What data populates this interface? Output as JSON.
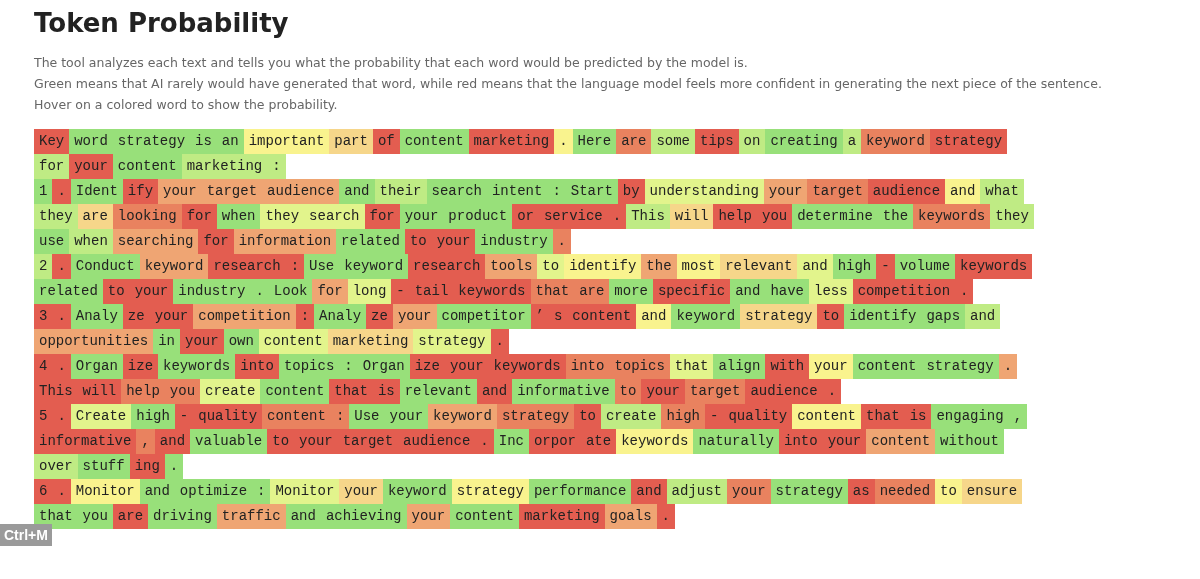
{
  "title": "Token Probability",
  "description": [
    "The tool analyzes each text and tells you what the probability that each word would be predicted by the model is.",
    "Green means that AI rarely would have generated that word, while red means that the language model feels more confident in generating the next piece of the sentence.",
    "Hover on a colored word to show the probability."
  ],
  "lines": [
    [
      {
        "text": "Key",
        "color": "#e35d50"
      },
      {
        "text": "word",
        "color": "#98e07a"
      },
      {
        "text": "strategy",
        "color": "#98e07a"
      },
      {
        "text": "is",
        "color": "#98e07a"
      },
      {
        "text": "an",
        "color": "#98e07a"
      },
      {
        "text": "important",
        "color": "#f9f38e"
      },
      {
        "text": "part",
        "color": "#f6d68a"
      },
      {
        "text": "of",
        "color": "#e35d50"
      },
      {
        "text": "content",
        "color": "#98e07a"
      },
      {
        "text": "marketing",
        "color": "#e35d50"
      },
      {
        "text": ".",
        "color": "#f9f38e"
      },
      {
        "text": "Here",
        "color": "#98e07a"
      },
      {
        "text": "are",
        "color": "#e9825f"
      },
      {
        "text": "some",
        "color": "#bfeb84"
      },
      {
        "text": "tips",
        "color": "#e35d50"
      },
      {
        "text": "on",
        "color": "#bfeb84"
      },
      {
        "text": "creating",
        "color": "#98e07a"
      },
      {
        "text": "a",
        "color": "#bfeb84"
      },
      {
        "text": "keyword",
        "color": "#e9825f"
      },
      {
        "text": "strategy",
        "color": "#e35d50"
      }
    ],
    [
      {
        "text": "for",
        "color": "#bfeb84"
      },
      {
        "text": "your",
        "color": "#e35d50"
      },
      {
        "text": "content",
        "color": "#98e07a"
      },
      {
        "text": "marketing",
        "color": "#bfeb84"
      },
      {
        "text": ":",
        "color": "#bfeb84"
      }
    ],
    [
      {
        "text": "1",
        "color": "#98e07a"
      },
      {
        "text": ".",
        "color": "#e35d50"
      },
      {
        "text": "Ident",
        "color": "#98e07a"
      },
      {
        "text": "ify",
        "color": "#e35d50"
      },
      {
        "text": "your",
        "color": "#efa573"
      },
      {
        "text": "target",
        "color": "#efa573"
      },
      {
        "text": "audience",
        "color": "#efa573"
      },
      {
        "text": "and",
        "color": "#98e07a"
      },
      {
        "text": "their",
        "color": "#bfeb84"
      },
      {
        "text": "search",
        "color": "#98e07a"
      },
      {
        "text": "intent",
        "color": "#98e07a"
      },
      {
        "text": ":",
        "color": "#98e07a"
      },
      {
        "text": "Start",
        "color": "#98e07a"
      },
      {
        "text": "by",
        "color": "#e35d50"
      },
      {
        "text": "understanding",
        "color": "#e2f48c"
      },
      {
        "text": "your",
        "color": "#efa573"
      },
      {
        "text": "target",
        "color": "#e9825f"
      },
      {
        "text": "audience",
        "color": "#e35d50"
      },
      {
        "text": "and",
        "color": "#f9f38e"
      },
      {
        "text": "what",
        "color": "#bfeb84"
      }
    ],
    [
      {
        "text": "they",
        "color": "#bfeb84"
      },
      {
        "text": "are",
        "color": "#f6d68a"
      },
      {
        "text": "looking",
        "color": "#e9825f"
      },
      {
        "text": "for",
        "color": "#e35d50"
      },
      {
        "text": "when",
        "color": "#98e07a"
      },
      {
        "text": "they",
        "color": "#e2f48c"
      },
      {
        "text": "search",
        "color": "#e2f48c"
      },
      {
        "text": "for",
        "color": "#e35d50"
      },
      {
        "text": "your",
        "color": "#98e07a"
      },
      {
        "text": "product",
        "color": "#98e07a"
      },
      {
        "text": "or",
        "color": "#e35d50"
      },
      {
        "text": "service",
        "color": "#e35d50"
      },
      {
        "text": ".",
        "color": "#e35d50"
      },
      {
        "text": "This",
        "color": "#bfeb84"
      },
      {
        "text": "will",
        "color": "#f6d68a"
      },
      {
        "text": "help",
        "color": "#e35d50"
      },
      {
        "text": "you",
        "color": "#e35d50"
      },
      {
        "text": "determine",
        "color": "#98e07a"
      },
      {
        "text": "the",
        "color": "#98e07a"
      },
      {
        "text": "keywords",
        "color": "#e9825f"
      },
      {
        "text": "they",
        "color": "#bfeb84"
      }
    ],
    [
      {
        "text": "use",
        "color": "#98e07a"
      },
      {
        "text": "when",
        "color": "#bfeb84"
      },
      {
        "text": "searching",
        "color": "#efa573"
      },
      {
        "text": "for",
        "color": "#e35d50"
      },
      {
        "text": "information",
        "color": "#efa573"
      },
      {
        "text": "related",
        "color": "#98e07a"
      },
      {
        "text": "to",
        "color": "#e35d50"
      },
      {
        "text": "your",
        "color": "#e35d50"
      },
      {
        "text": "industry",
        "color": "#98e07a"
      },
      {
        "text": ".",
        "color": "#e9825f"
      }
    ],
    [
      {
        "text": "2",
        "color": "#bfeb84"
      },
      {
        "text": ".",
        "color": "#e35d50"
      },
      {
        "text": "Conduct",
        "color": "#98e07a"
      },
      {
        "text": "keyword",
        "color": "#efa573"
      },
      {
        "text": "research",
        "color": "#e35d50"
      },
      {
        "text": ":",
        "color": "#e35d50"
      },
      {
        "text": "Use",
        "color": "#98e07a"
      },
      {
        "text": "keyword",
        "color": "#98e07a"
      },
      {
        "text": "research",
        "color": "#e35d50"
      },
      {
        "text": "tools",
        "color": "#efa573"
      },
      {
        "text": "to",
        "color": "#e2f48c"
      },
      {
        "text": "identify",
        "color": "#f9f38e"
      },
      {
        "text": "the",
        "color": "#efa573"
      },
      {
        "text": "most",
        "color": "#f9f38e"
      },
      {
        "text": "relevant",
        "color": "#f6d68a"
      },
      {
        "text": "and",
        "color": "#e2f48c"
      },
      {
        "text": "high",
        "color": "#98e07a"
      },
      {
        "text": "-",
        "color": "#e35d50"
      },
      {
        "text": "volume",
        "color": "#98e07a"
      },
      {
        "text": "keywords",
        "color": "#e35d50"
      }
    ],
    [
      {
        "text": "related",
        "color": "#98e07a"
      },
      {
        "text": "to",
        "color": "#e35d50"
      },
      {
        "text": "your",
        "color": "#e35d50"
      },
      {
        "text": "industry",
        "color": "#98e07a"
      },
      {
        "text": ".",
        "color": "#98e07a"
      },
      {
        "text": "Look",
        "color": "#98e07a"
      },
      {
        "text": "for",
        "color": "#efa573"
      },
      {
        "text": "long",
        "color": "#e2f48c"
      },
      {
        "text": "-",
        "color": "#e35d50"
      },
      {
        "text": "tail",
        "color": "#e35d50"
      },
      {
        "text": "keywords",
        "color": "#e35d50"
      },
      {
        "text": "that",
        "color": "#e9825f"
      },
      {
        "text": "are",
        "color": "#e9825f"
      },
      {
        "text": "more",
        "color": "#98e07a"
      },
      {
        "text": "specific",
        "color": "#e35d50"
      },
      {
        "text": "and",
        "color": "#98e07a"
      },
      {
        "text": "have",
        "color": "#98e07a"
      },
      {
        "text": "less",
        "color": "#e2f48c"
      },
      {
        "text": "competition",
        "color": "#e35d50"
      },
      {
        "text": ".",
        "color": "#e35d50"
      }
    ],
    [
      {
        "text": "3",
        "color": "#e35d50"
      },
      {
        "text": ".",
        "color": "#e35d50"
      },
      {
        "text": "Analy",
        "color": "#98e07a"
      },
      {
        "text": "ze",
        "color": "#e35d50"
      },
      {
        "text": "your",
        "color": "#e35d50"
      },
      {
        "text": "competition",
        "color": "#efa573"
      },
      {
        "text": ":",
        "color": "#e35d50"
      },
      {
        "text": "Analy",
        "color": "#98e07a"
      },
      {
        "text": "ze",
        "color": "#e35d50"
      },
      {
        "text": "your",
        "color": "#efa573"
      },
      {
        "text": "competitor",
        "color": "#98e07a"
      },
      {
        "text": "’",
        "color": "#e35d50"
      },
      {
        "text": "s",
        "color": "#e35d50"
      },
      {
        "text": "content",
        "color": "#e35d50"
      },
      {
        "text": "and",
        "color": "#f9f38e"
      },
      {
        "text": "keyword",
        "color": "#98e07a"
      },
      {
        "text": "strategy",
        "color": "#f6d68a"
      },
      {
        "text": "to",
        "color": "#e35d50"
      },
      {
        "text": "identify",
        "color": "#98e07a"
      },
      {
        "text": "gaps",
        "color": "#98e07a"
      },
      {
        "text": "and",
        "color": "#bfeb84"
      }
    ],
    [
      {
        "text": "opportunities",
        "color": "#efa573"
      },
      {
        "text": "in",
        "color": "#98e07a"
      },
      {
        "text": "your",
        "color": "#e35d50"
      },
      {
        "text": "own",
        "color": "#98e07a"
      },
      {
        "text": "content",
        "color": "#e2f48c"
      },
      {
        "text": "marketing",
        "color": "#f6d68a"
      },
      {
        "text": "strategy",
        "color": "#e2f48c"
      },
      {
        "text": ".",
        "color": "#e35d50"
      }
    ],
    [
      {
        "text": "4",
        "color": "#e35d50"
      },
      {
        "text": ".",
        "color": "#e35d50"
      },
      {
        "text": "Organ",
        "color": "#98e07a"
      },
      {
        "text": "ize",
        "color": "#e35d50"
      },
      {
        "text": "keywords",
        "color": "#98e07a"
      },
      {
        "text": "into",
        "color": "#e35d50"
      },
      {
        "text": "topics",
        "color": "#98e07a"
      },
      {
        "text": ":",
        "color": "#98e07a"
      },
      {
        "text": "Organ",
        "color": "#98e07a"
      },
      {
        "text": "ize",
        "color": "#e35d50"
      },
      {
        "text": "your",
        "color": "#e35d50"
      },
      {
        "text": "keywords",
        "color": "#e35d50"
      },
      {
        "text": "into",
        "color": "#e9825f"
      },
      {
        "text": "topics",
        "color": "#e9825f"
      },
      {
        "text": "that",
        "color": "#e2f48c"
      },
      {
        "text": "align",
        "color": "#98e07a"
      },
      {
        "text": "with",
        "color": "#e35d50"
      },
      {
        "text": "your",
        "color": "#f9f38e"
      },
      {
        "text": "content",
        "color": "#98e07a"
      },
      {
        "text": "strategy",
        "color": "#98e07a"
      },
      {
        "text": ".",
        "color": "#efa573"
      }
    ],
    [
      {
        "text": "This",
        "color": "#e35d50"
      },
      {
        "text": "will",
        "color": "#e35d50"
      },
      {
        "text": "help",
        "color": "#e9825f"
      },
      {
        "text": "you",
        "color": "#e9825f"
      },
      {
        "text": "create",
        "color": "#e2f48c"
      },
      {
        "text": "content",
        "color": "#98e07a"
      },
      {
        "text": "that",
        "color": "#e35d50"
      },
      {
        "text": "is",
        "color": "#e35d50"
      },
      {
        "text": "relevant",
        "color": "#98e07a"
      },
      {
        "text": "and",
        "color": "#e35d50"
      },
      {
        "text": "informative",
        "color": "#98e07a"
      },
      {
        "text": "to",
        "color": "#e9825f"
      },
      {
        "text": "your",
        "color": "#e35d50"
      },
      {
        "text": "target",
        "color": "#e9825f"
      },
      {
        "text": "audience",
        "color": "#e35d50"
      },
      {
        "text": ".",
        "color": "#e35d50"
      }
    ],
    [
      {
        "text": "5",
        "color": "#e35d50"
      },
      {
        "text": ".",
        "color": "#e35d50"
      },
      {
        "text": "Create",
        "color": "#e2f48c"
      },
      {
        "text": "high",
        "color": "#98e07a"
      },
      {
        "text": "-",
        "color": "#e35d50"
      },
      {
        "text": "quality",
        "color": "#e35d50"
      },
      {
        "text": "content",
        "color": "#e9825f"
      },
      {
        "text": ":",
        "color": "#e9825f"
      },
      {
        "text": "Use",
        "color": "#98e07a"
      },
      {
        "text": "your",
        "color": "#98e07a"
      },
      {
        "text": "keyword",
        "color": "#efa573"
      },
      {
        "text": "strategy",
        "color": "#e9825f"
      },
      {
        "text": "to",
        "color": "#e35d50"
      },
      {
        "text": "create",
        "color": "#bfeb84"
      },
      {
        "text": "high",
        "color": "#e9825f"
      },
      {
        "text": "-",
        "color": "#e35d50"
      },
      {
        "text": "quality",
        "color": "#e35d50"
      },
      {
        "text": "content",
        "color": "#f9f38e"
      },
      {
        "text": "that",
        "color": "#e35d50"
      },
      {
        "text": "is",
        "color": "#e35d50"
      },
      {
        "text": "engaging",
        "color": "#98e07a"
      },
      {
        "text": ",",
        "color": "#98e07a"
      }
    ],
    [
      {
        "text": "informative",
        "color": "#e35d50"
      },
      {
        "text": ",",
        "color": "#e9825f"
      },
      {
        "text": "and",
        "color": "#e35d50"
      },
      {
        "text": "valuable",
        "color": "#98e07a"
      },
      {
        "text": "to",
        "color": "#e35d50"
      },
      {
        "text": "your",
        "color": "#e35d50"
      },
      {
        "text": "target",
        "color": "#e35d50"
      },
      {
        "text": "audience",
        "color": "#e35d50"
      },
      {
        "text": ".",
        "color": "#e35d50"
      },
      {
        "text": "Inc",
        "color": "#98e07a"
      },
      {
        "text": "orpor",
        "color": "#e35d50"
      },
      {
        "text": "ate",
        "color": "#e35d50"
      },
      {
        "text": "keywords",
        "color": "#f9f38e"
      },
      {
        "text": "naturally",
        "color": "#98e07a"
      },
      {
        "text": "into",
        "color": "#e35d50"
      },
      {
        "text": "your",
        "color": "#e35d50"
      },
      {
        "text": "content",
        "color": "#efa573"
      },
      {
        "text": "without",
        "color": "#98e07a"
      }
    ],
    [
      {
        "text": "over",
        "color": "#bfeb84"
      },
      {
        "text": "stuff",
        "color": "#98e07a"
      },
      {
        "text": "ing",
        "color": "#e35d50"
      },
      {
        "text": ".",
        "color": "#98e07a"
      }
    ],
    [
      {
        "text": "6",
        "color": "#e35d50"
      },
      {
        "text": ".",
        "color": "#e35d50"
      },
      {
        "text": "Monitor",
        "color": "#f9f38e"
      },
      {
        "text": "and",
        "color": "#98e07a"
      },
      {
        "text": "optimize",
        "color": "#98e07a"
      },
      {
        "text": ":",
        "color": "#98e07a"
      },
      {
        "text": "Monitor",
        "color": "#e2f48c"
      },
      {
        "text": "your",
        "color": "#f6d68a"
      },
      {
        "text": "keyword",
        "color": "#98e07a"
      },
      {
        "text": "strategy",
        "color": "#f9f38e"
      },
      {
        "text": "performance",
        "color": "#98e07a"
      },
      {
        "text": "and",
        "color": "#e35d50"
      },
      {
        "text": "adjust",
        "color": "#bfeb84"
      },
      {
        "text": "your",
        "color": "#e9825f"
      },
      {
        "text": "strategy",
        "color": "#98e07a"
      },
      {
        "text": "as",
        "color": "#e35d50"
      },
      {
        "text": "needed",
        "color": "#e9825f"
      },
      {
        "text": "to",
        "color": "#f9f38e"
      },
      {
        "text": "ensure",
        "color": "#f6d68a"
      }
    ],
    [
      {
        "text": "that",
        "color": "#98e07a"
      },
      {
        "text": "you",
        "color": "#98e07a"
      },
      {
        "text": "are",
        "color": "#e35d50"
      },
      {
        "text": "driving",
        "color": "#98e07a"
      },
      {
        "text": "traffic",
        "color": "#efa573"
      },
      {
        "text": "and",
        "color": "#98e07a"
      },
      {
        "text": "achieving",
        "color": "#98e07a"
      },
      {
        "text": "your",
        "color": "#efa573"
      },
      {
        "text": "content",
        "color": "#98e07a"
      },
      {
        "text": "marketing",
        "color": "#e35d50"
      },
      {
        "text": "goals",
        "color": "#efa573"
      },
      {
        "text": ".",
        "color": "#e35d50"
      }
    ]
  ],
  "shortcut_badge": "Ctrl+M"
}
